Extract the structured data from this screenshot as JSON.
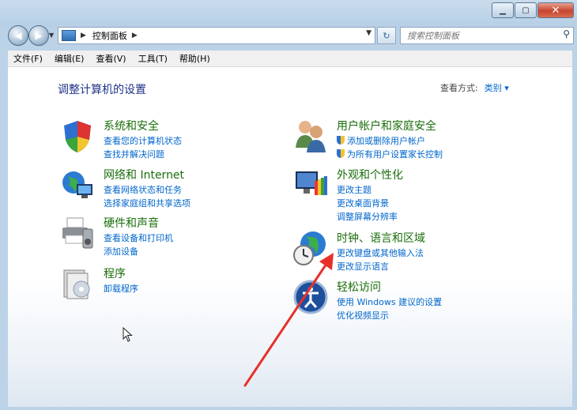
{
  "nav": {
    "breadcrumb": "控制面板",
    "search_placeholder": "搜索控制面板"
  },
  "menu": [
    "文件(F)",
    "编辑(E)",
    "查看(V)",
    "工具(T)",
    "帮助(H)"
  ],
  "page": {
    "title": "调整计算机的设置",
    "view_by_label": "查看方式:",
    "view_by_value": "类别 ▾"
  },
  "categories": [
    {
      "title": "系统和安全",
      "links": [
        "查看您的计算机状态",
        "查找并解决问题"
      ]
    },
    {
      "title": "网络和 Internet",
      "links": [
        "查看网络状态和任务",
        "选择家庭组和共享选项"
      ]
    },
    {
      "title": "硬件和声音",
      "links": [
        "查看设备和打印机",
        "添加设备"
      ]
    },
    {
      "title": "程序",
      "links": [
        "卸载程序"
      ]
    },
    {
      "title": "用户帐户和家庭安全",
      "links": [
        "添加或删除用户帐户",
        "为所有用户设置家长控制"
      ]
    },
    {
      "title": "外观和个性化",
      "links": [
        "更改主题",
        "更改桌面背景",
        "调整屏幕分辨率"
      ]
    },
    {
      "title": "时钟、语言和区域",
      "links": [
        "更改键盘或其他输入法",
        "更改显示语言"
      ]
    },
    {
      "title": "轻松访问",
      "links": [
        "使用 Windows 建议的设置",
        "优化视频显示"
      ]
    }
  ],
  "colors": {
    "title_green": "#1a6d0a",
    "link_blue": "#0066cc",
    "annotation_red": "#e8302a"
  }
}
